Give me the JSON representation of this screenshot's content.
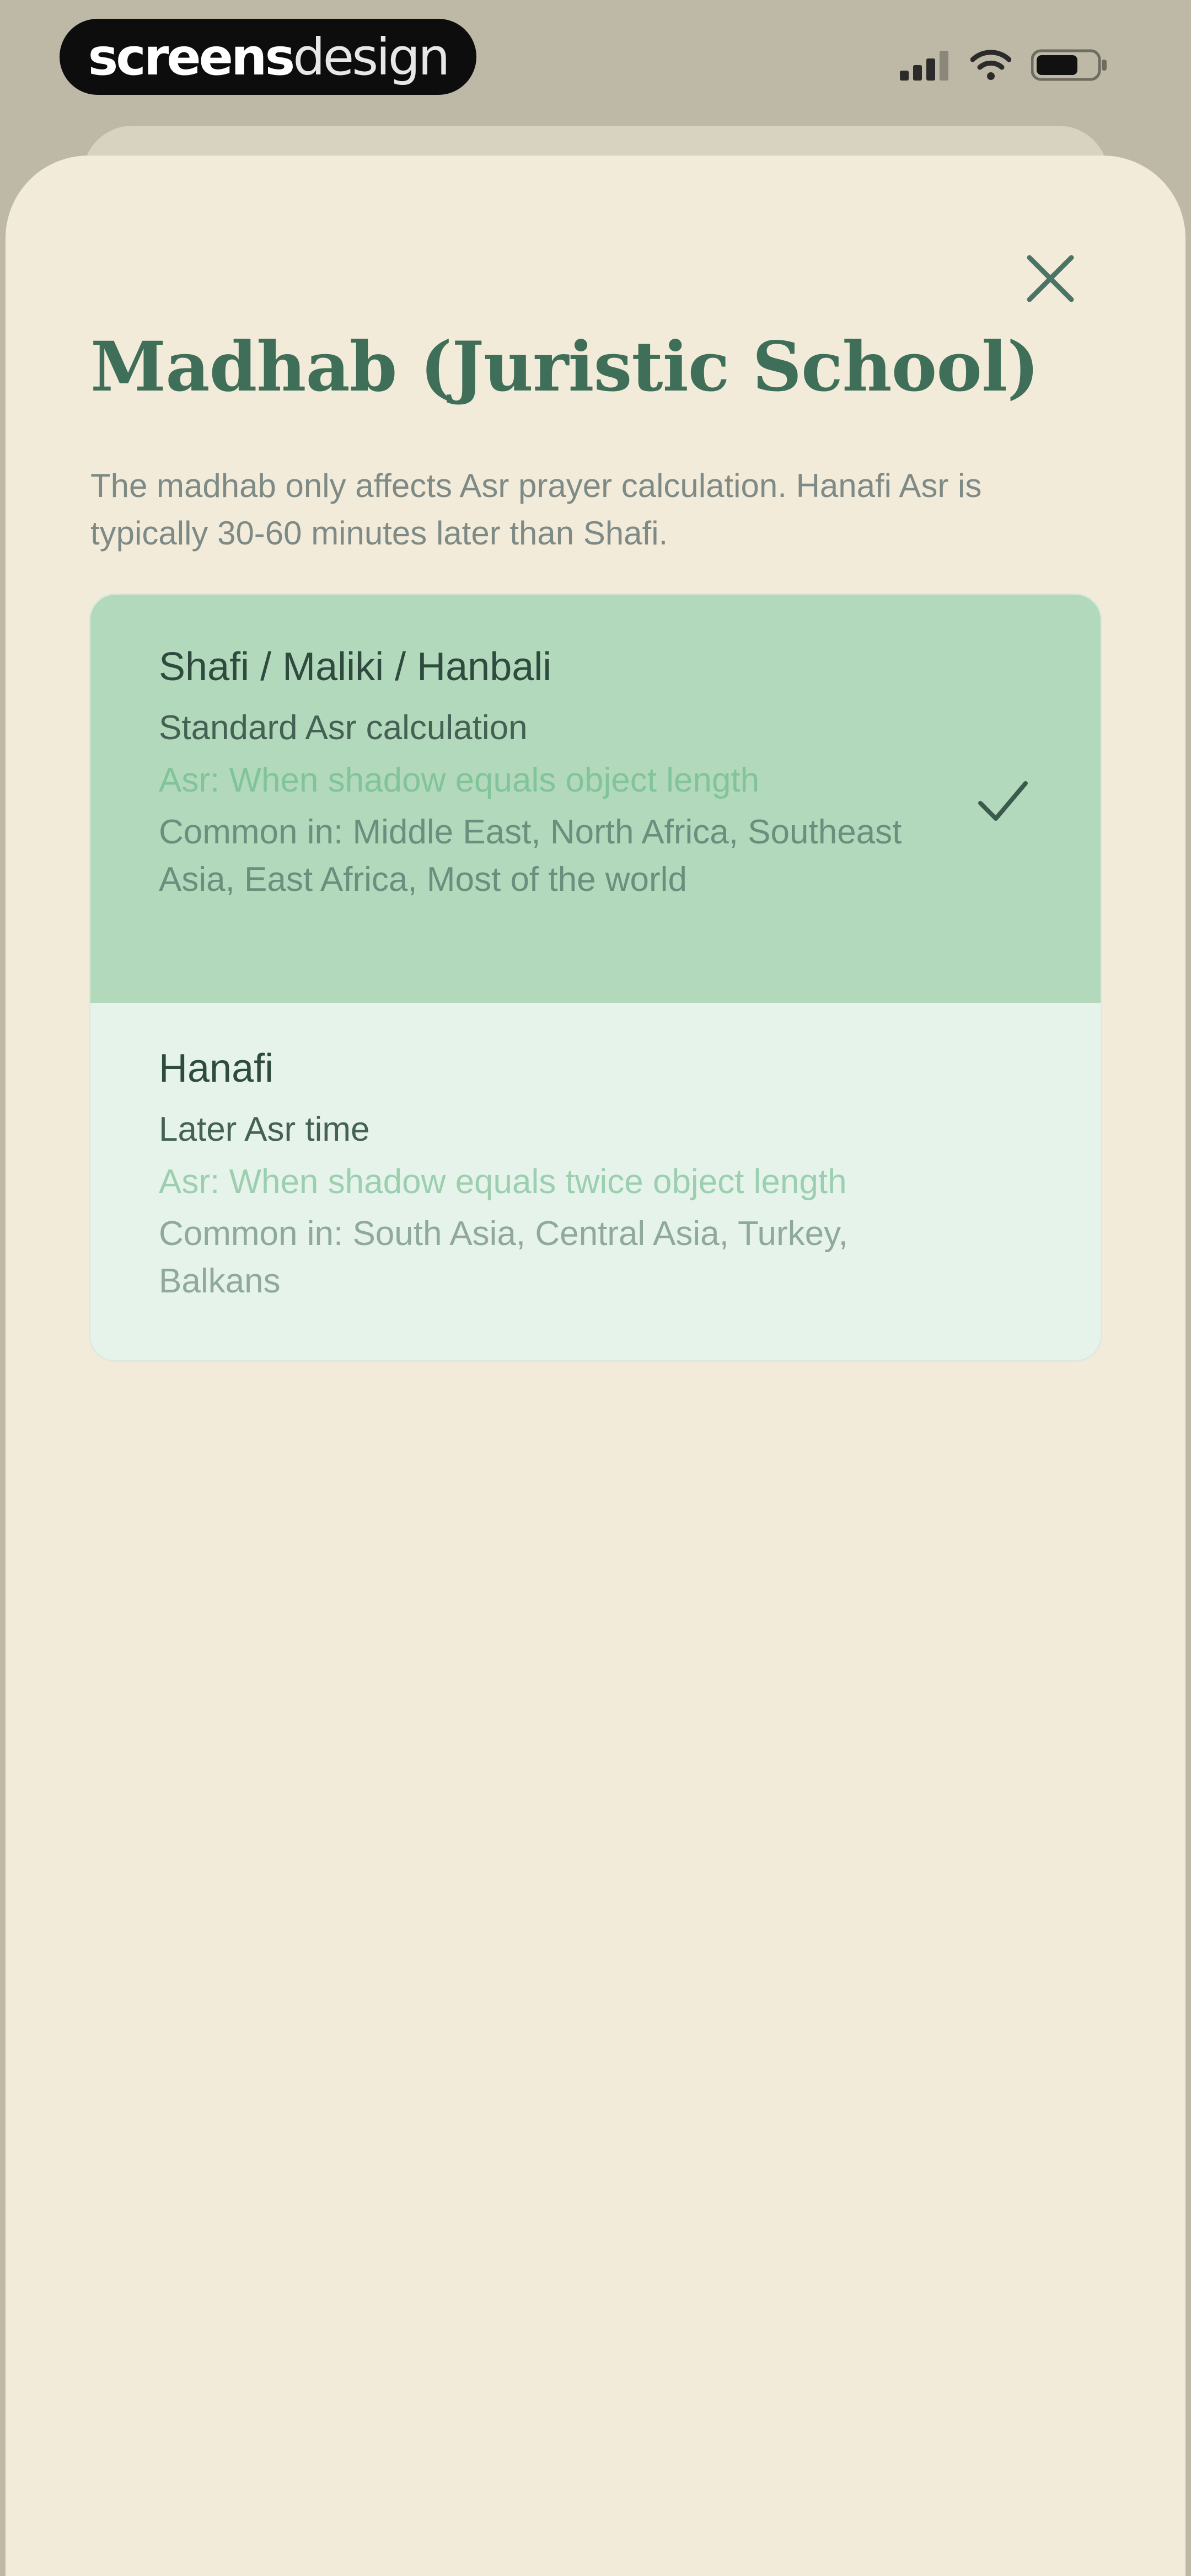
{
  "status_bar": {
    "brand_bold": "screens",
    "brand_light": "design",
    "icons": [
      "cellular-signal-icon",
      "wifi-icon",
      "battery-icon"
    ]
  },
  "sheet": {
    "title": "Madhab (Juristic School)",
    "description": "The madhab only affects Asr prayer calculation. Hanafi Asr is typically 30-60 minutes later than Shafi.",
    "close_icon": "close-icon",
    "options": [
      {
        "name": "Shafi / Maliki / Hanbali",
        "subtitle": "Standard Asr calculation",
        "rule": "Asr: When shadow equals object length",
        "common": "Common in: Middle East, North Africa, Southeast Asia, East Africa, Most of the world",
        "selected": true
      },
      {
        "name": "Hanafi",
        "subtitle": "Later Asr time",
        "rule": "Asr: When shadow equals twice object length",
        "common": "Common in: South Asia, Central Asia, Turkey, Balkans",
        "selected": false
      }
    ]
  },
  "colors": {
    "backdrop": "#bdb9a6",
    "sheet": "#f3ebda",
    "title": "#3f6f58",
    "selected_bg": "#b2d9bb",
    "unselected_bg": "#e6f3ea",
    "accent": "#82c49a"
  }
}
